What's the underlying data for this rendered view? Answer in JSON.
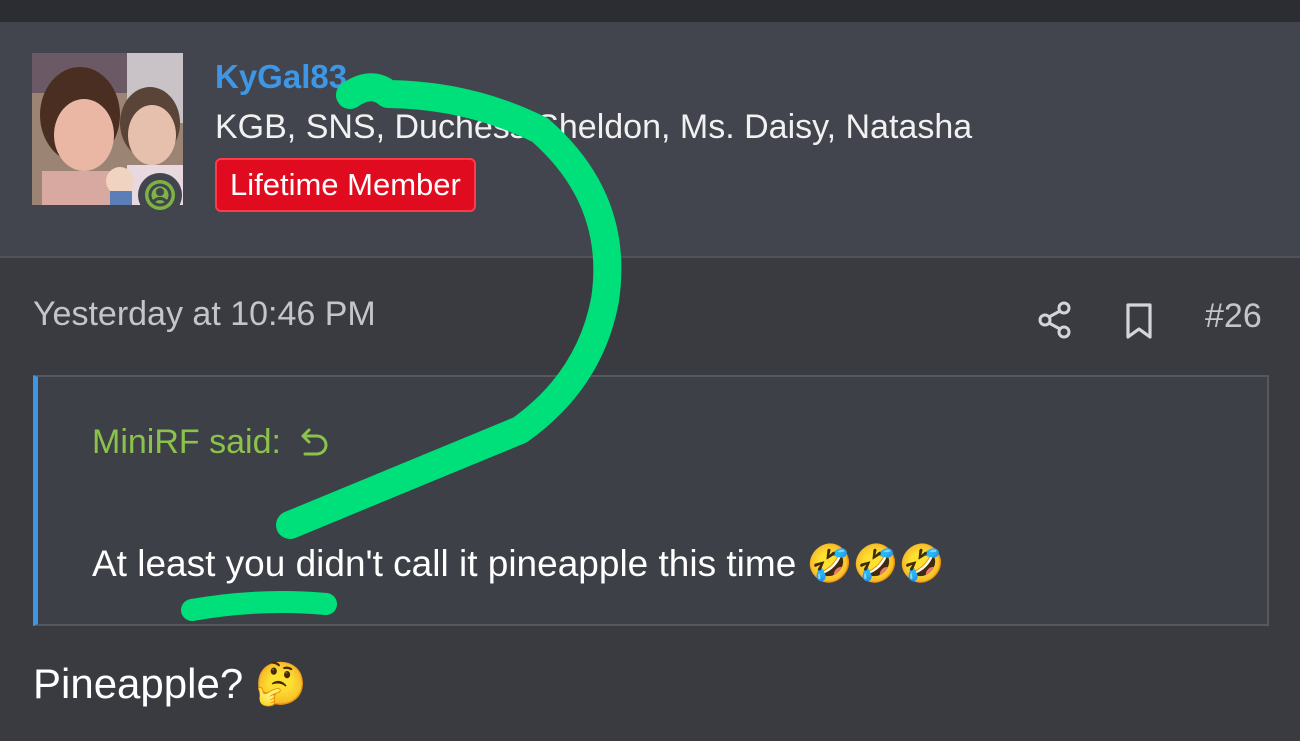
{
  "post": {
    "author": {
      "username": "KyGal83",
      "title": "KGB, SNS, Duchess Sheldon, Ms. Daisy, Natasha",
      "badge": "Lifetime Member"
    },
    "timestamp": "Yesterday at 10:46 PM",
    "post_number": "#26",
    "quote": {
      "author": "MiniRF said:",
      "text": "At least you didn't call it pineapple this time 🤣🤣🤣"
    },
    "message": "Pineapple? 🤔"
  },
  "icons": {
    "share": "share-icon",
    "bookmark": "bookmark-icon",
    "reply": "reply-arrow-icon",
    "online": "online-status-icon"
  },
  "colors": {
    "username": "#3d97e6",
    "quote_author": "#8bc34a",
    "badge": "#e00b1e",
    "annotation": "#00e07a"
  }
}
